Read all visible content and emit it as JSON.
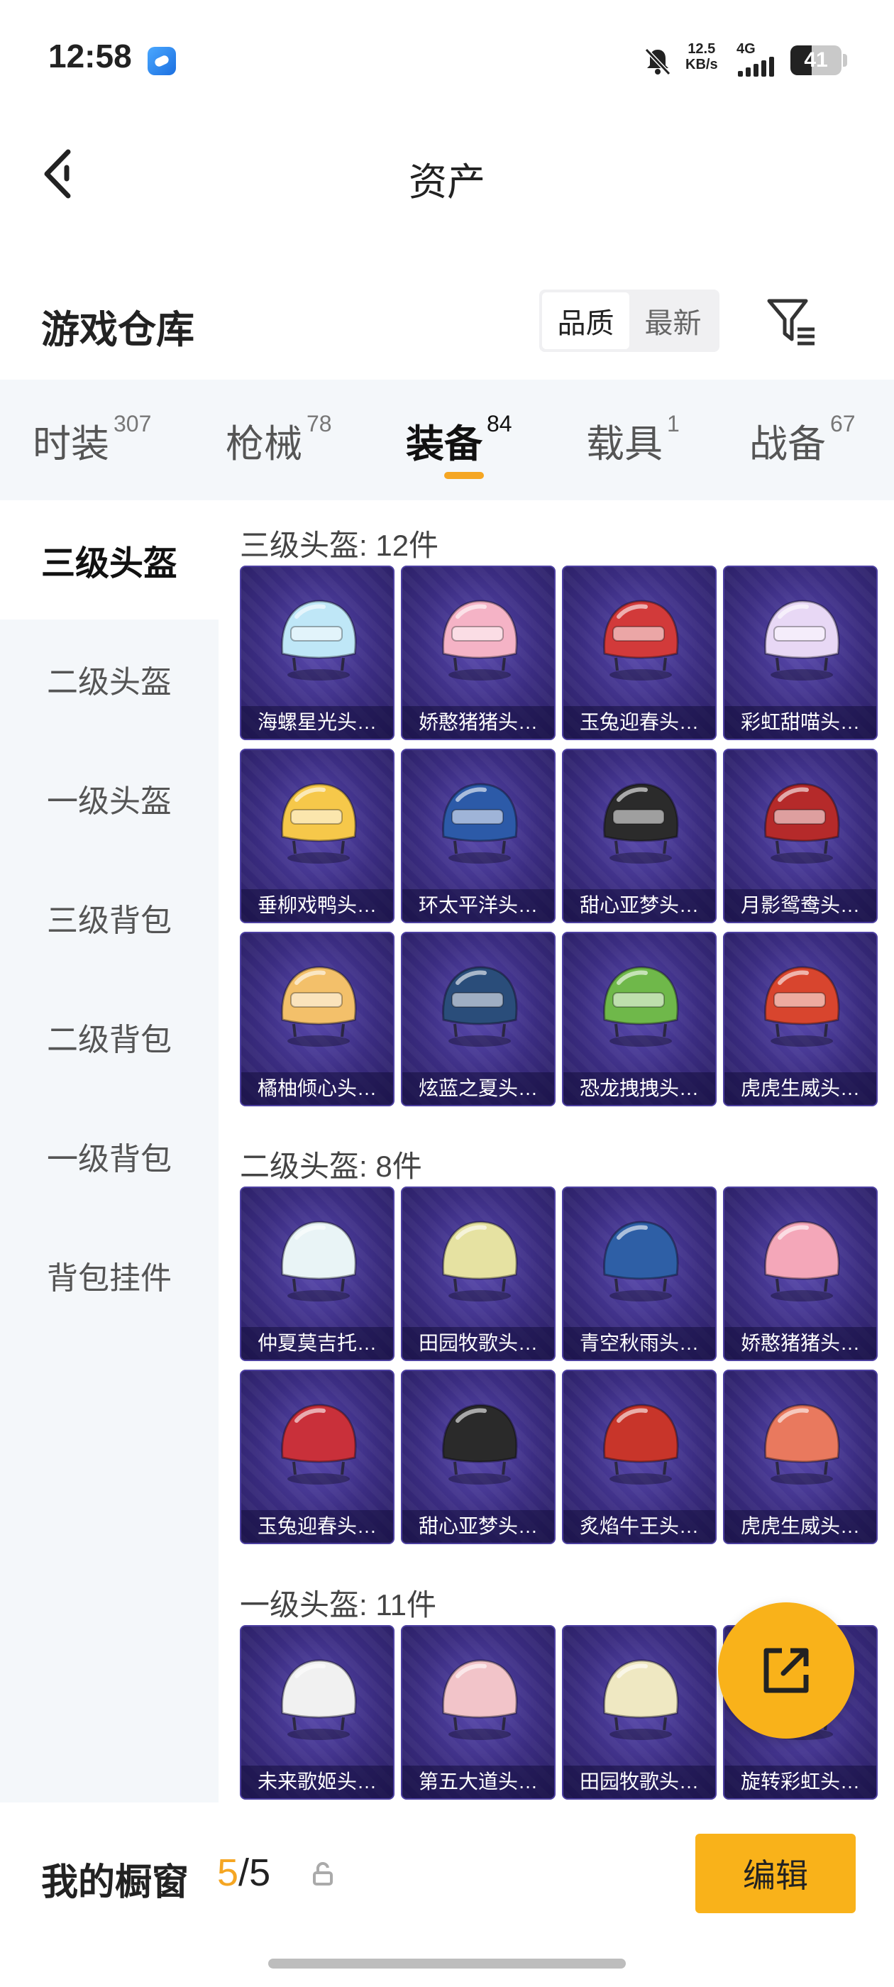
{
  "status_bar": {
    "time": "12:58",
    "net_speed_value": "12.5",
    "net_speed_unit": "KB/s",
    "network": "4G",
    "battery": "41",
    "battery_level": 0.41
  },
  "header": {
    "title": "资产"
  },
  "warehouse": {
    "title": "游戏仓库",
    "sort_options": [
      "品质",
      "最新"
    ],
    "active_sort": 0
  },
  "tabs": [
    {
      "label": "时装",
      "count": "307"
    },
    {
      "label": "枪械",
      "count": "78"
    },
    {
      "label": "装备",
      "count": "84"
    },
    {
      "label": "载具",
      "count": "1"
    },
    {
      "label": "战备",
      "count": "67"
    }
  ],
  "active_tab": 2,
  "sidebar": {
    "items": [
      "三级头盔",
      "二级头盔",
      "一级头盔",
      "三级背包",
      "二级背包",
      "一级背包",
      "背包挂件"
    ],
    "active": 0
  },
  "groups": [
    {
      "title": "三级头盔: 12件",
      "items": [
        {
          "name": "海螺星光头…",
          "color": "#bfe7f7"
        },
        {
          "name": "娇憨猪猪头…",
          "color": "#f5b3c6"
        },
        {
          "name": "玉兔迎春头…",
          "color": "#d23a3a"
        },
        {
          "name": "彩虹甜喵头…",
          "color": "#e8d8f5"
        },
        {
          "name": "垂柳戏鸭头…",
          "color": "#f6c84a"
        },
        {
          "name": "环太平洋头…",
          "color": "#2c5aa8"
        },
        {
          "name": "甜心亚梦头…",
          "color": "#2b2b2b"
        },
        {
          "name": "月影鸳鸯头…",
          "color": "#b52a2a"
        },
        {
          "name": "橘柚倾心头…",
          "color": "#f3c06a"
        },
        {
          "name": "炫蓝之夏头…",
          "color": "#2a4d7a"
        },
        {
          "name": "恐龙拽拽头…",
          "color": "#6fb84a"
        },
        {
          "name": "虎虎生威头…",
          "color": "#d8452e"
        }
      ]
    },
    {
      "title": "二级头盔: 8件",
      "items": [
        {
          "name": "仲夏莫吉托…",
          "color": "#e9f4f6"
        },
        {
          "name": "田园牧歌头…",
          "color": "#e6e2a2"
        },
        {
          "name": "青空秋雨头…",
          "color": "#2e5fa6"
        },
        {
          "name": "娇憨猪猪头…",
          "color": "#f4a7b9"
        },
        {
          "name": "玉兔迎春头…",
          "color": "#c9303a"
        },
        {
          "name": "甜心亚梦头…",
          "color": "#2a2a2a"
        },
        {
          "name": "炙焰牛王头…",
          "color": "#c8352a"
        },
        {
          "name": "虎虎生威头…",
          "color": "#e9795e"
        }
      ]
    },
    {
      "title": "一级头盔: 11件",
      "items": [
        {
          "name": "未来歌姬头…",
          "color": "#f1f1f1"
        },
        {
          "name": "第五大道头…",
          "color": "#f2c4c9"
        },
        {
          "name": "田园牧歌头…",
          "color": "#efe8c2"
        },
        {
          "name": "旋转彩虹头…",
          "color": "#f3b6c8"
        }
      ]
    }
  ],
  "showcase": {
    "label": "我的橱窗",
    "current": "5",
    "separator": "/",
    "total": "5"
  },
  "edit_label": "编辑"
}
